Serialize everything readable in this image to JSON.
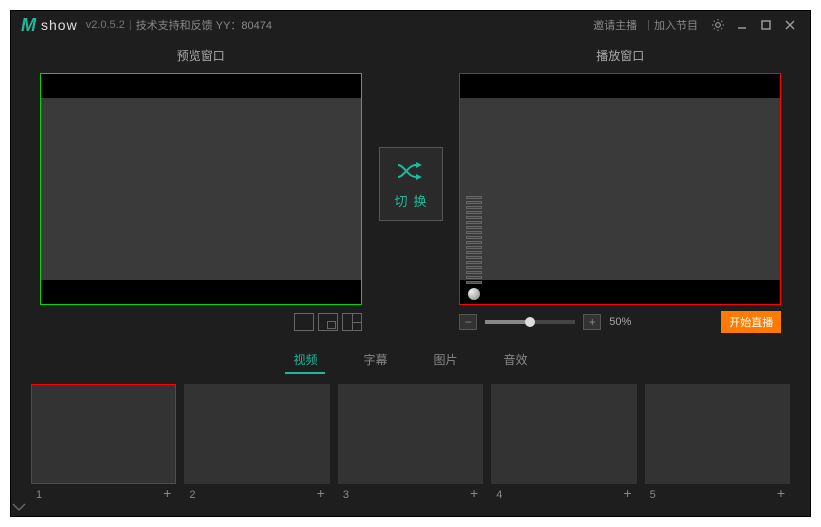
{
  "app": {
    "logo_m": "M",
    "logo_show": "show",
    "version": "v2.0.5.2",
    "support_link": "技术支持和反馈 YY：80474",
    "invite_link": "邀请主播",
    "join_link": "加入节目"
  },
  "panes": {
    "preview_title": "预览窗口",
    "playback_title": "播放窗口"
  },
  "switch": {
    "label": "切换"
  },
  "volume": {
    "minus": "−",
    "plus": "+",
    "percent": "50%",
    "value": 50
  },
  "buttons": {
    "start_live": "开始直播"
  },
  "tabs": [
    {
      "label": "视频",
      "active": true
    },
    {
      "label": "字幕",
      "active": false
    },
    {
      "label": "图片",
      "active": false
    },
    {
      "label": "音效",
      "active": false
    }
  ],
  "thumbs": [
    {
      "num": "1",
      "selected": true
    },
    {
      "num": "2",
      "selected": false
    },
    {
      "num": "3",
      "selected": false
    },
    {
      "num": "4",
      "selected": false
    },
    {
      "num": "5",
      "selected": false
    }
  ],
  "colors": {
    "accent": "#1fb89a",
    "preview_border": "#00d800",
    "playback_border": "#ff0000",
    "start_live": "#ff7a00"
  }
}
